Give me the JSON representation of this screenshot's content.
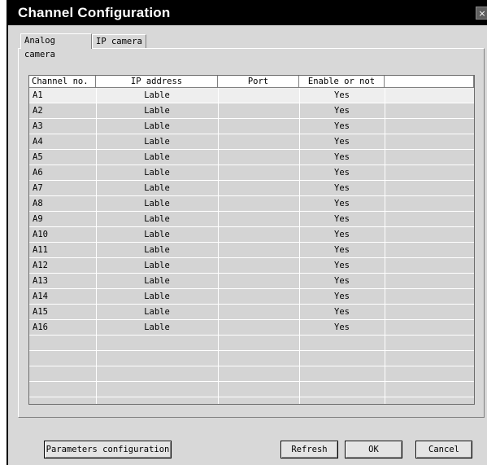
{
  "window": {
    "title": "Channel Configuration",
    "close_glyph": "×"
  },
  "tabs": [
    {
      "label": "Analog camera",
      "active": true
    },
    {
      "label": "IP camera",
      "active": false
    }
  ],
  "table": {
    "columns": [
      "Channel no.",
      "IP address",
      "Port",
      "Enable or not",
      ""
    ],
    "rows": [
      {
        "channel": "A1",
        "ip": "Lable",
        "port": "",
        "enable": "Yes"
      },
      {
        "channel": "A2",
        "ip": "Lable",
        "port": "",
        "enable": "Yes"
      },
      {
        "channel": "A3",
        "ip": "Lable",
        "port": "",
        "enable": "Yes"
      },
      {
        "channel": "A4",
        "ip": "Lable",
        "port": "",
        "enable": "Yes"
      },
      {
        "channel": "A5",
        "ip": "Lable",
        "port": "",
        "enable": "Yes"
      },
      {
        "channel": "A6",
        "ip": "Lable",
        "port": "",
        "enable": "Yes"
      },
      {
        "channel": "A7",
        "ip": "Lable",
        "port": "",
        "enable": "Yes"
      },
      {
        "channel": "A8",
        "ip": "Lable",
        "port": "",
        "enable": "Yes"
      },
      {
        "channel": "A9",
        "ip": "Lable",
        "port": "",
        "enable": "Yes"
      },
      {
        "channel": "A10",
        "ip": "Lable",
        "port": "",
        "enable": "Yes"
      },
      {
        "channel": "A11",
        "ip": "Lable",
        "port": "",
        "enable": "Yes"
      },
      {
        "channel": "A12",
        "ip": "Lable",
        "port": "",
        "enable": "Yes"
      },
      {
        "channel": "A13",
        "ip": "Lable",
        "port": "",
        "enable": "Yes"
      },
      {
        "channel": "A14",
        "ip": "Lable",
        "port": "",
        "enable": "Yes"
      },
      {
        "channel": "A15",
        "ip": "Lable",
        "port": "",
        "enable": "Yes"
      },
      {
        "channel": "A16",
        "ip": "Lable",
        "port": "",
        "enable": "Yes"
      }
    ],
    "selected_row": "A1",
    "empty_rows": 4
  },
  "buttons": {
    "params": "Parameters configuration",
    "refresh": "Refresh",
    "ok": "OK",
    "cancel": "Cancel"
  },
  "colors": {
    "titlebar": "#000000",
    "client": "#d8d8d8",
    "list_bg": "#d4d4d4",
    "selected_row": "#eeeeee"
  }
}
